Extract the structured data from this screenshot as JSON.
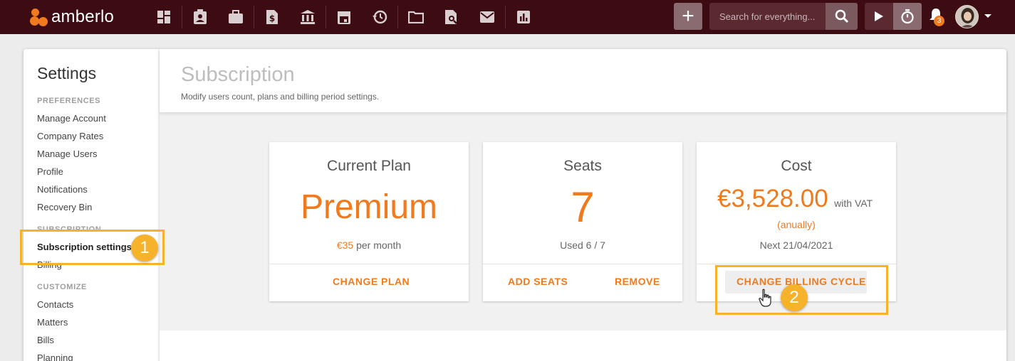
{
  "app": {
    "brand": "amberlo"
  },
  "topbar": {
    "nav_icons": [
      "dashboard-icon",
      "contacts-icon",
      "matters-icon",
      "bills-icon",
      "bank-icon",
      "calendar-icon",
      "time-history-icon",
      "folder-icon",
      "document-search-icon",
      "mail-icon",
      "reports-icon"
    ],
    "add_label": "+",
    "search_placeholder": "Search for everything...",
    "notification_count": "3"
  },
  "sidebar": {
    "title": "Settings",
    "sections": [
      {
        "header": "PREFERENCES",
        "items": [
          "Manage Account",
          "Company Rates",
          "Manage Users",
          "Profile",
          "Notifications",
          "Recovery Bin"
        ]
      },
      {
        "header": "SUBSCRIPTION",
        "items": [
          "Subscription settings",
          "Billing"
        ]
      },
      {
        "header": "CUSTOMIZE",
        "items": [
          "Contacts",
          "Matters",
          "Bills",
          "Planning"
        ]
      }
    ],
    "active_item": "Subscription settings"
  },
  "page": {
    "title": "Subscription",
    "subtitle": "Modify users count, plans and billing period settings."
  },
  "cards": {
    "plan": {
      "title": "Current Plan",
      "value": "Premium",
      "price": "€35",
      "price_suffix": "per month",
      "action": "CHANGE PLAN"
    },
    "seats": {
      "title": "Seats",
      "value": "7",
      "usage": "Used 6 / 7",
      "add_action": "ADD SEATS",
      "remove_action": "REMOVE"
    },
    "cost": {
      "title": "Cost",
      "value": "€3,528.00",
      "vat_note": "with VAT",
      "period": "(anually)",
      "next": "Next 21/04/2021",
      "action": "CHANGE BILLING CYCLE"
    }
  },
  "annotations": {
    "step1": "1",
    "step2": "2"
  },
  "colors": {
    "accent": "#f07a1e",
    "topbar": "#3d0b12",
    "highlight": "#f6b22a"
  }
}
